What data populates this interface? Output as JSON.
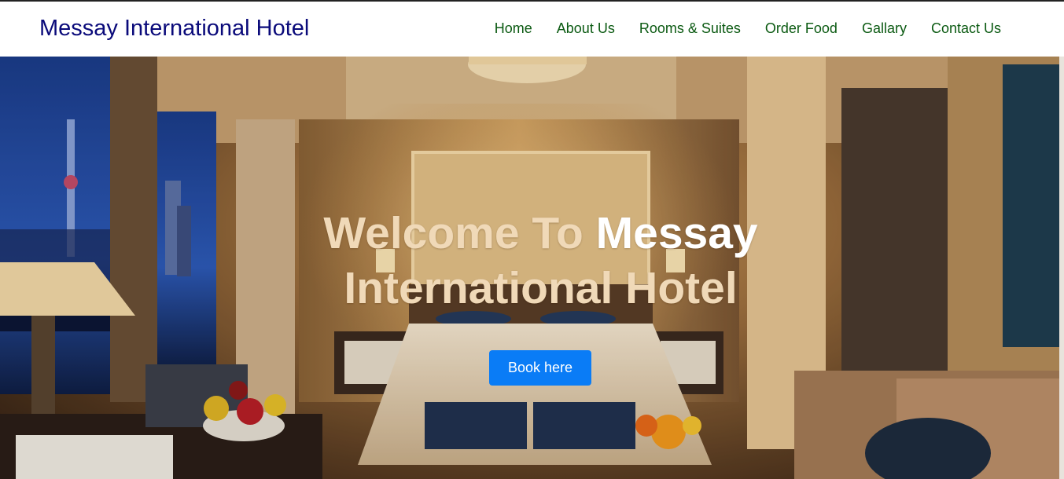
{
  "header": {
    "brand": "Messay International Hotel",
    "nav": [
      "Home",
      "About Us",
      "Rooms & Suites",
      "Order Food",
      "Gallary",
      "Contact Us"
    ]
  },
  "hero": {
    "title_part1": "Welcome To",
    "title_part2": "Messay",
    "title_line2": "International Hotel",
    "button_label": "Book here",
    "image_description_icon": "hotel-room-photo"
  },
  "colors": {
    "brand": "#0a0a7a",
    "nav_link": "#0b5a12",
    "button": "#0a7cf6"
  }
}
